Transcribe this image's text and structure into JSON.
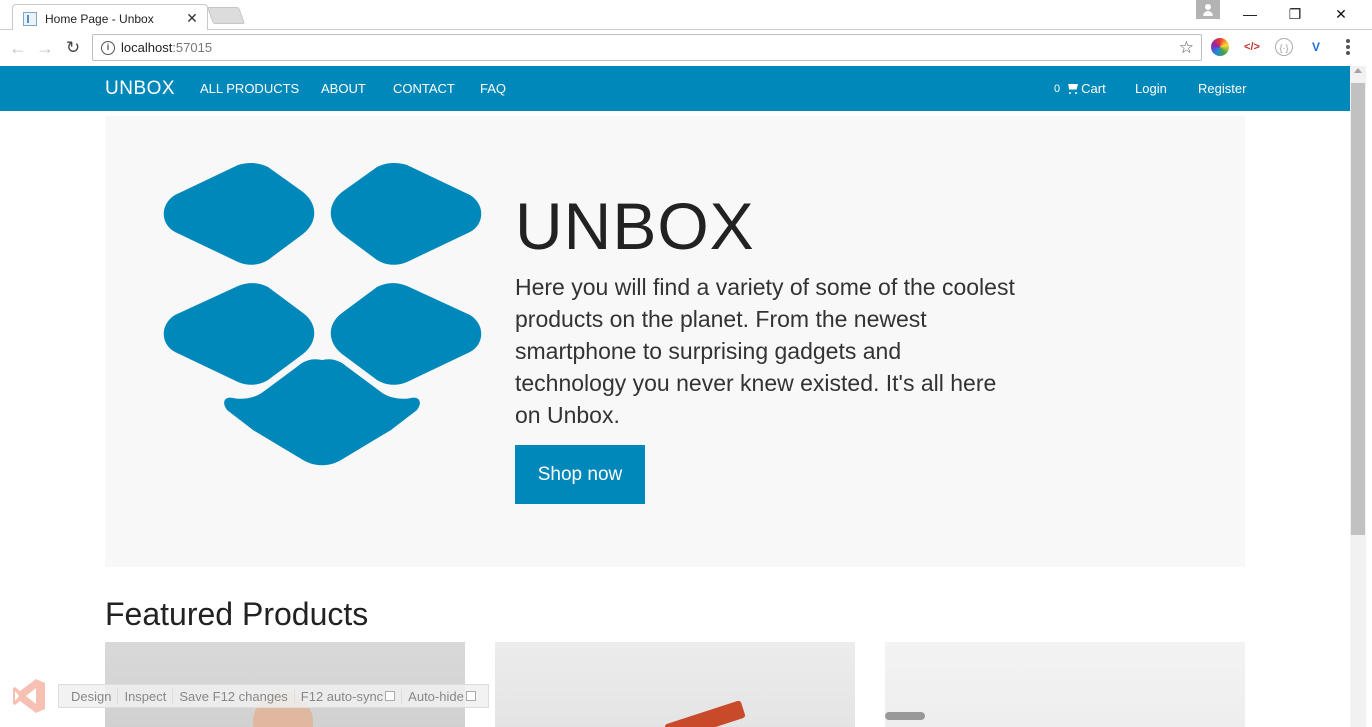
{
  "browser": {
    "tab_title": "Home Page - Unbox",
    "tab_close": "✕",
    "url_host": "localhost",
    "url_port": ":57015",
    "window_min": "—",
    "window_max": "❐",
    "window_close": "✕"
  },
  "navbar": {
    "brand": "UNBOX",
    "links": [
      "ALL PRODUCTS",
      "ABOUT",
      "CONTACT",
      "FAQ"
    ],
    "cart_count": "0",
    "cart_label": "Cart",
    "login": "Login",
    "register": "Register"
  },
  "hero": {
    "title": "UNBOX",
    "text": "Here you will find a variety of some of the coolest products on the planet. From the newest smartphone to surprising gadgets and technology you never knew existed. It's all here on Unbox.",
    "button": "Shop now",
    "accent_color": "#0088bb"
  },
  "featured": {
    "title": "Featured Products"
  },
  "devtools": {
    "items": [
      "Design",
      "Inspect",
      "Save F12 changes",
      "F12 auto-sync",
      "Auto-hide"
    ]
  }
}
